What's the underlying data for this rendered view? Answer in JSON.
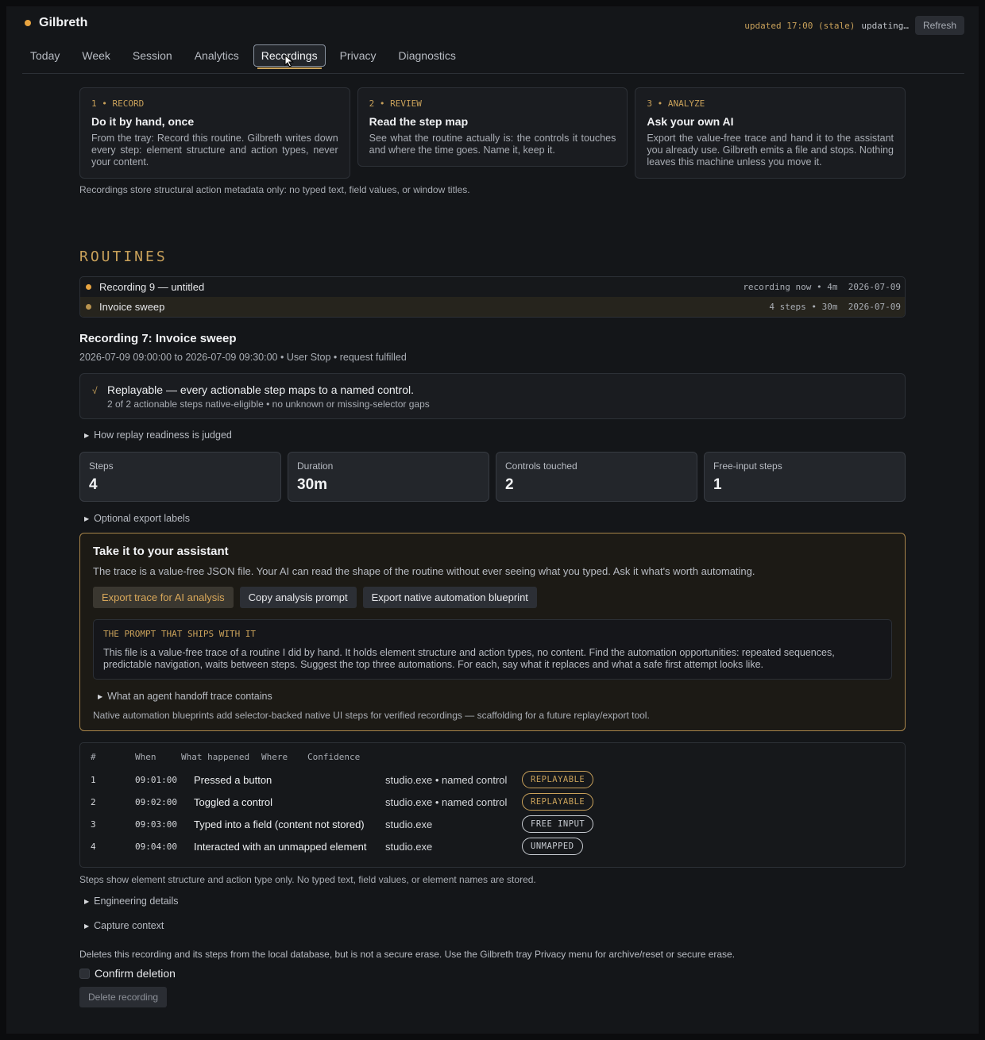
{
  "app": {
    "title": "Gilbreth"
  },
  "status": {
    "stale": "updated 17:00 (stale)",
    "updating": "updating…",
    "refresh_label": "Refresh"
  },
  "tabs": [
    "Today",
    "Week",
    "Session",
    "Analytics",
    "Recordings",
    "Privacy",
    "Diagnostics"
  ],
  "active_tab": "Recordings",
  "steps": [
    {
      "label": "1 • RECORD",
      "title": "Do it by hand, once",
      "body": "From the tray: Record this routine. Gilbreth writes down every step: element structure and action types, never your content."
    },
    {
      "label": "2 • REVIEW",
      "title": "Read the step map",
      "body": "See what the routine actually is: the controls it touches and where the time goes. Name it, keep it."
    },
    {
      "label": "3 • ANALYZE",
      "title": "Ask your own AI",
      "body": "Export the value-free trace and hand it to the assistant you already use. Gilbreth emits a file and stops. Nothing leaves this machine unless you move it."
    }
  ],
  "steps_note": "Recordings store structural action metadata only: no typed text, field values, or window titles.",
  "routines": {
    "title": "ROUTINES",
    "items": [
      {
        "name": "Recording 9 — untitled",
        "meta": "recording now • 4m  2026-07-09",
        "dot_color": "#e8a440",
        "selected": false
      },
      {
        "name": "Invoice sweep",
        "meta": "4 steps • 30m  2026-07-09",
        "dot_color": "#b8934e",
        "selected": true
      }
    ]
  },
  "recording": {
    "title": "Recording 7: Invoice sweep",
    "subtitle": "2026-07-09 09:00:00 to 2026-07-09 09:30:00 • User Stop • request fulfilled",
    "ready_title": "Replayable — every actionable step maps to a named control.",
    "ready_sub": "2 of 2 actionable steps native-eligible • no unknown or missing-selector gaps",
    "ready_mark": "√",
    "how_judged": "How replay readiness is judged",
    "stats": [
      {
        "label": "Steps",
        "value": "4"
      },
      {
        "label": "Duration",
        "value": "30m"
      },
      {
        "label": "Controls touched",
        "value": "2"
      },
      {
        "label": "Free-input steps",
        "value": "1"
      }
    ],
    "export_labels": "Optional export labels"
  },
  "assistant": {
    "title": "Take it to your assistant",
    "desc": "The trace is a value-free JSON file. Your AI can read the shape of the routine without ever seeing what you typed. Ask it what's worth automating.",
    "buttons": [
      "Export trace for AI analysis",
      "Copy analysis prompt",
      "Export native automation blueprint"
    ],
    "prompt_label": "THE PROMPT THAT SHIPS WITH IT",
    "prompt_text": "This file is a value-free trace of a routine I did by hand. It holds element structure and action types, no content. Find the automation opportunities: repeated sequences, predictable navigation, waits between steps. Suggest the top three automations. For each, say what it replaces and what a safe first attempt looks like.",
    "handoff": "What an agent handoff trace contains",
    "foot": "Native automation blueprints add selector-backed native UI steps for verified recordings — scaffolding for a future replay/export tool."
  },
  "table": {
    "headers": [
      "#",
      "When",
      "What happened",
      "Where",
      "Confidence"
    ],
    "rows": [
      {
        "num": "1",
        "when": "09:01:00",
        "what": "Pressed a button",
        "where": "studio.exe • named control",
        "confidence": "REPLAYABLE",
        "kind": "replayable"
      },
      {
        "num": "2",
        "when": "09:02:00",
        "what": "Toggled a control",
        "where": "studio.exe • named control",
        "confidence": "REPLAYABLE",
        "kind": "replayable"
      },
      {
        "num": "3",
        "when": "09:03:00",
        "what": "Typed into a field (content not stored)",
        "where": "studio.exe",
        "confidence": "FREE INPUT",
        "kind": "free"
      },
      {
        "num": "4",
        "when": "09:04:00",
        "what": "Interacted with an unmapped element",
        "where": "studio.exe",
        "confidence": "UNMAPPED",
        "kind": "unmapped"
      }
    ],
    "note": "Steps show element structure and action type only. No typed text, field values, or element names are stored."
  },
  "footer": {
    "engineering": "Engineering details",
    "capture": "Capture context",
    "delete_note": "Deletes this recording and its steps from the local database, but is not a secure erase. Use the Gilbreth tray Privacy menu for archive/reset or secure erase.",
    "confirm": "Confirm deletion",
    "delete_label": "Delete recording"
  }
}
